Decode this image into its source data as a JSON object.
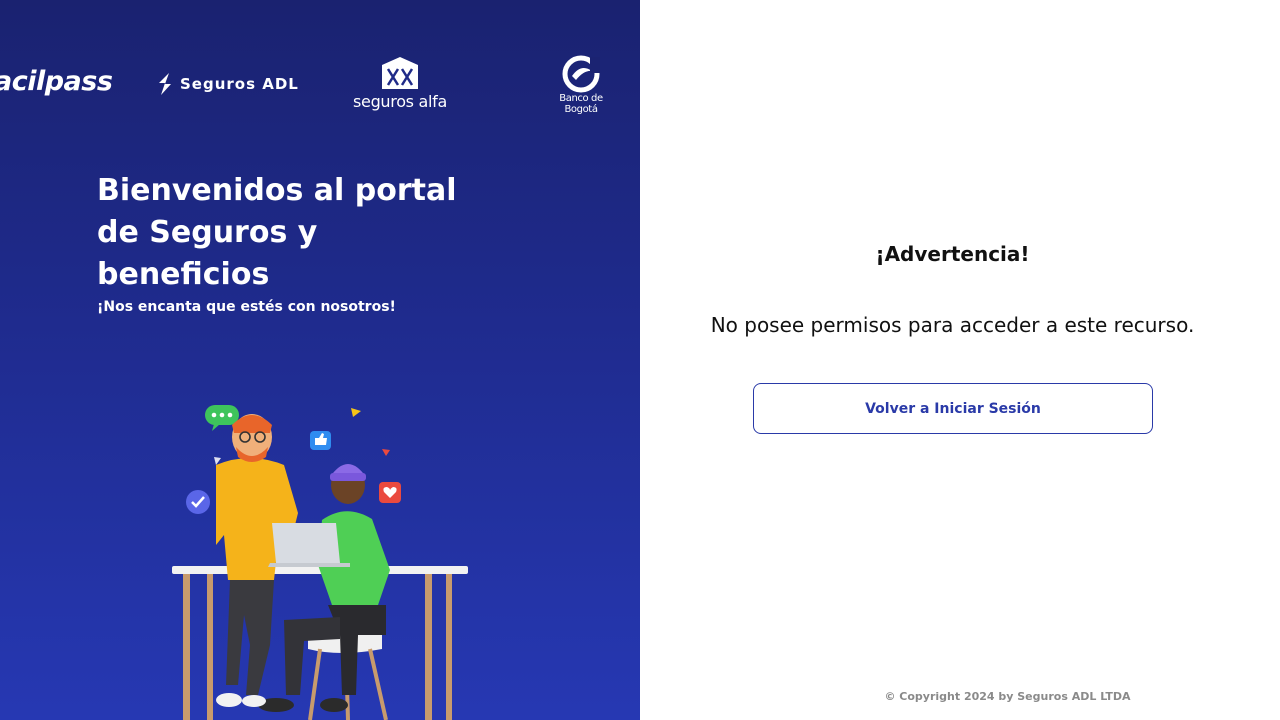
{
  "logos": {
    "facilpass": "acilpass",
    "seguros_adl": "Seguros ADL",
    "seguros_alfa": "seguros alfa",
    "banco_bogota_line1": "Banco de",
    "banco_bogota_line2": "Bogotá"
  },
  "welcome": {
    "title": "Bienvenidos al portal de Seguros y beneficios",
    "subtitle": "¡Nos encanta que estés con nosotros!"
  },
  "warning": {
    "title": "¡Advertencia!",
    "message": "No posee permisos para acceder a este recurso.",
    "button_label": "Volver a Iniciar Sesión"
  },
  "footer": {
    "copyright": "© Copyright 2024 by Seguros ADL LTDA"
  },
  "colors": {
    "panel_dark": "#1a2270",
    "panel_light": "#2638b3",
    "accent": "#2a3aa8"
  },
  "icons": [
    "seguros-adl-logo-icon",
    "seguros-alfa-logo-icon",
    "banco-bogota-logo-icon",
    "chat-bubble-icon",
    "like-icon",
    "heart-icon",
    "check-icon"
  ]
}
